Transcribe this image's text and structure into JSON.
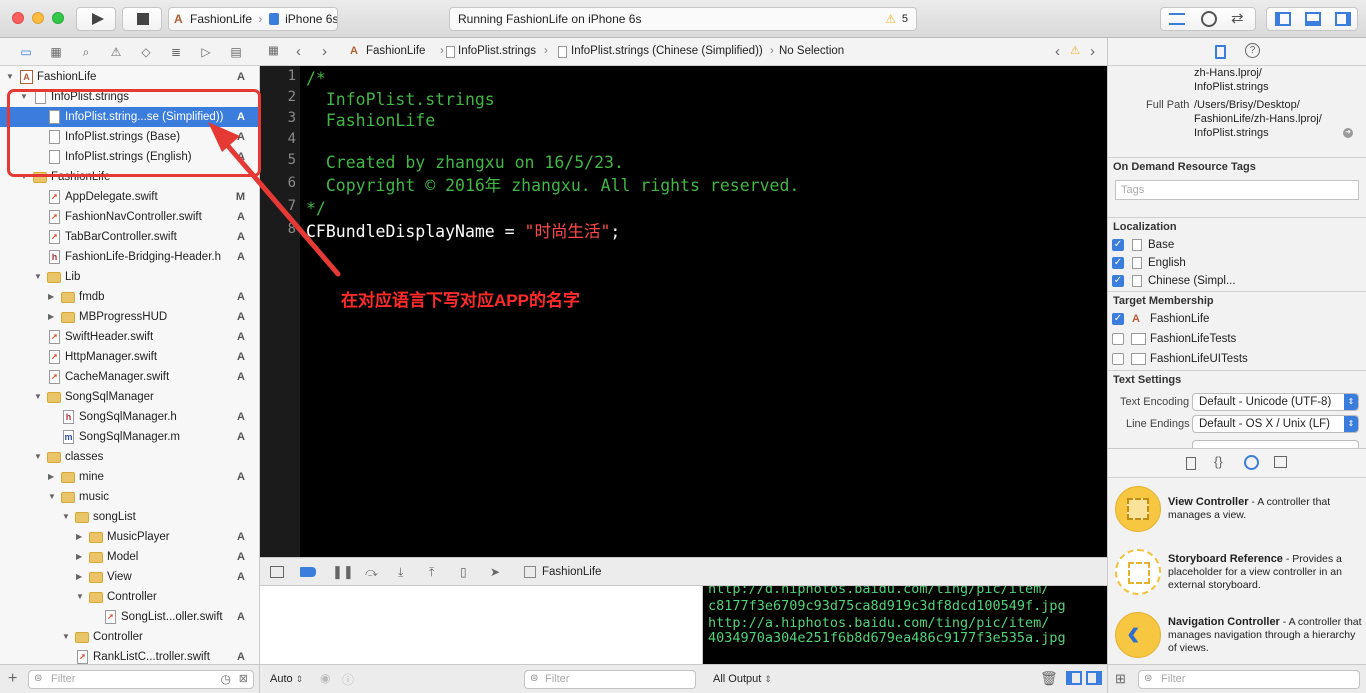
{
  "toolbar": {
    "scheme_project": "FashionLife",
    "scheme_device": "iPhone 6s",
    "status_text": "Running FashionLife on iPhone 6s",
    "warning_count": "5"
  },
  "jumpbar": {
    "crumbs": [
      "FashionLife",
      "InfoPlist.strings",
      "InfoPlist.strings (Chinese (Simplified))",
      "No Selection"
    ]
  },
  "navigator": {
    "rows": [
      {
        "label": "FashionLife",
        "badge": "A"
      },
      {
        "label": "InfoPlist.strings",
        "badge": ""
      },
      {
        "label": "InfoPlist.string...se (Simplified))",
        "badge": "A"
      },
      {
        "label": "InfoPlist.strings (Base)",
        "badge": "A"
      },
      {
        "label": "InfoPlist.strings (English)",
        "badge": "A"
      },
      {
        "label": "FashionLife",
        "badge": ""
      },
      {
        "label": "AppDelegate.swift",
        "badge": "M"
      },
      {
        "label": "FashionNavController.swift",
        "badge": "A"
      },
      {
        "label": "TabBarController.swift",
        "badge": "A"
      },
      {
        "label": "FashionLife-Bridging-Header.h",
        "badge": "A"
      },
      {
        "label": "Lib",
        "badge": ""
      },
      {
        "label": "fmdb",
        "badge": "A"
      },
      {
        "label": "MBProgressHUD",
        "badge": "A"
      },
      {
        "label": "SwiftHeader.swift",
        "badge": "A"
      },
      {
        "label": "HttpManager.swift",
        "badge": "A"
      },
      {
        "label": "CacheManager.swift",
        "badge": "A"
      },
      {
        "label": "SongSqlManager",
        "badge": ""
      },
      {
        "label": "SongSqlManager.h",
        "badge": "A"
      },
      {
        "label": "SongSqlManager.m",
        "badge": "A"
      },
      {
        "label": "classes",
        "badge": ""
      },
      {
        "label": "mine",
        "badge": "A"
      },
      {
        "label": "music",
        "badge": ""
      },
      {
        "label": "songList",
        "badge": ""
      },
      {
        "label": "MusicPlayer",
        "badge": "A"
      },
      {
        "label": "Model",
        "badge": "A"
      },
      {
        "label": "View",
        "badge": "A"
      },
      {
        "label": "Controller",
        "badge": ""
      },
      {
        "label": "SongList...oller.swift",
        "badge": "A"
      },
      {
        "label": "Controller",
        "badge": ""
      },
      {
        "label": "RankListC...troller.swift",
        "badge": "A"
      }
    ],
    "filter_placeholder": "Filter"
  },
  "editor": {
    "line_numbers": [
      "1",
      "2",
      "3",
      "4",
      "5",
      "6",
      "7",
      "8"
    ],
    "lines": [
      "/*",
      "  InfoPlist.strings",
      "  FashionLife",
      "",
      "  Created by zhangxu on 16/5/23.",
      "  Copyright © 2016年 zhangxu. All rights reserved.",
      "*/",
      ""
    ],
    "line8_key": "CFBundleDisplayName = ",
    "line8_value": "\"时尚生活\"",
    "line8_end": ";"
  },
  "annotation": {
    "text": "在对应语言下写对应APP的名字"
  },
  "debug": {
    "target": "FashionLife",
    "console_lines": [
      "http://d.hiphotos.baidu.com/ting/pic/item/",
      "c8177f3e6709c93d75ca8d919c3df8dcd100549f.jpg",
      "http://a.hiphotos.baidu.com/ting/pic/item/",
      "4034970a304e251f6b8d679ea486c9177f3e535a.jpg"
    ],
    "auto_label": "Auto",
    "filter_placeholder": "Filter",
    "output_label": "All Output"
  },
  "inspector": {
    "path_top_1": "zh-Hans.lproj/",
    "path_top_2": "InfoPlist.strings",
    "full_path_label": "Full Path",
    "full_path_1": "/Users/Brisy/Desktop/",
    "full_path_2": "FashionLife/zh-Hans.lproj/",
    "full_path_3": "InfoPlist.strings",
    "odr_title": "On Demand Resource Tags",
    "tags_placeholder": "Tags",
    "localization_title": "Localization",
    "localizations": [
      {
        "label": "Base",
        "checked": true
      },
      {
        "label": "English",
        "checked": true
      },
      {
        "label": "Chinese (Simpl...",
        "checked": true
      }
    ],
    "target_title": "Target Membership",
    "targets": [
      {
        "label": "FashionLife",
        "checked": true
      },
      {
        "label": "FashionLifeTests",
        "checked": false
      },
      {
        "label": "FashionLifeUITests",
        "checked": false
      }
    ],
    "text_settings_title": "Text Settings",
    "encoding_label": "Text Encoding",
    "encoding_value": "Default - Unicode (UTF-8)",
    "endings_label": "Line Endings",
    "endings_value": "Default - OS X / Unix (LF)"
  },
  "library": {
    "items": [
      {
        "title": "View Controller",
        "desc": " - A controller that manages a view."
      },
      {
        "title": "Storyboard Reference",
        "desc": " - Provides a placeholder for a view controller in an external storyboard."
      },
      {
        "title": "Navigation Controller",
        "desc": " - A controller that manages navigation through a hierarchy of views."
      }
    ],
    "filter_placeholder": "Filter"
  },
  "colors": {
    "selection": "#3b7ddd",
    "comment": "#41b645",
    "string": "#ff4a4a",
    "annotation": "#e53935"
  }
}
